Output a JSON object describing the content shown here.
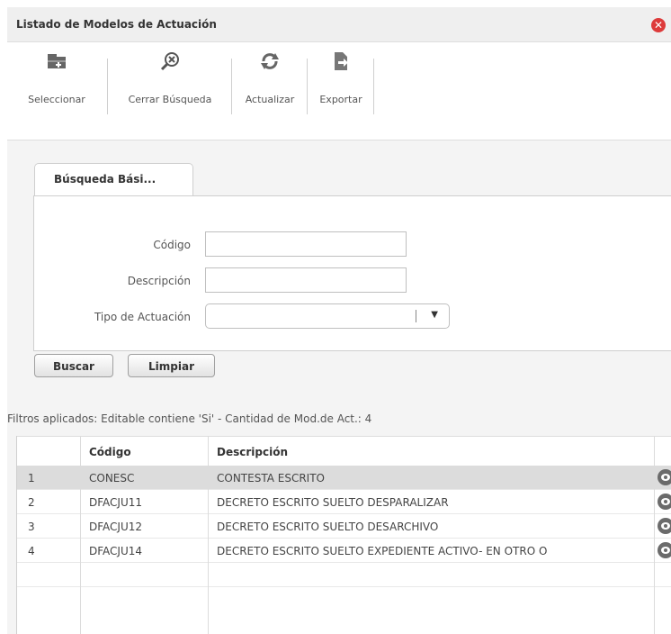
{
  "window": {
    "title": "Listado de Modelos de Actuación"
  },
  "toolbar": {
    "buttons": [
      {
        "label": "Seleccionar",
        "icon": "folder-add-icon"
      },
      {
        "label": "Cerrar Búsqueda",
        "icon": "search-close-icon"
      },
      {
        "label": "Actualizar",
        "icon": "refresh-icon"
      },
      {
        "label": "Exportar",
        "icon": "export-icon"
      }
    ],
    "close_icon": "close-icon"
  },
  "search": {
    "tab_label": "Búsqueda Bási...",
    "fields": [
      {
        "label": "Código",
        "value": ""
      },
      {
        "label": "Descripción",
        "value": ""
      },
      {
        "label": "Tipo de Actuación",
        "value": ""
      }
    ],
    "buscar_label": "Buscar",
    "limpiar_label": "Limpiar"
  },
  "filters_text": "Filtros aplicados: Editable contiene 'Si' - Cantidad de Mod.de Act.: 4",
  "table": {
    "headers": [
      "",
      "Código",
      "Descripción",
      ""
    ],
    "rows": [
      {
        "num": "1",
        "codigo": "CONESC",
        "descripcion": "CONTESTA ESCRITO",
        "selected": true
      },
      {
        "num": "2",
        "codigo": "DFACJU11",
        "descripcion": "DECRETO ESCRITO SUELTO DESPARALIZAR",
        "selected": false
      },
      {
        "num": "3",
        "codigo": "DFACJU12",
        "descripcion": "DECRETO ESCRITO SUELTO DESARCHIVO",
        "selected": false
      },
      {
        "num": "4",
        "codigo": "DFACJU14",
        "descripcion": "DECRETO ESCRITO SUELTO EXPEDIENTE ACTIVO- EN OTRO O",
        "selected": false
      }
    ],
    "row_icon": "eye-icon"
  },
  "colors": {
    "close": "#dd3b3b",
    "selected_row": "#dcdcdc",
    "panel_border": "#cfcfcf"
  }
}
